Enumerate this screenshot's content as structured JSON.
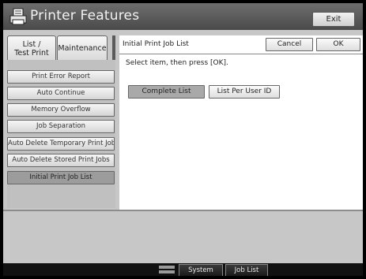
{
  "header": {
    "title": "Printer Features",
    "exit_label": "Exit"
  },
  "tabs": [
    {
      "label": "List / Test Print"
    },
    {
      "label": "Maintenance"
    }
  ],
  "menu_items": [
    {
      "label": "Print Error Report"
    },
    {
      "label": "Auto Continue"
    },
    {
      "label": "Memory Overflow"
    },
    {
      "label": "Job Separation"
    },
    {
      "label": "Auto Delete Temporary Print Jobs"
    },
    {
      "label": "Auto Delete Stored Print Jobs"
    },
    {
      "label": "Initial Print Job List",
      "selected": true
    }
  ],
  "dialog": {
    "title": "Initial Print Job List",
    "cancel_label": "Cancel",
    "ok_label": "OK",
    "instruction": "Select item, then press [OK].",
    "options": [
      {
        "label": "Complete List",
        "selected": true
      },
      {
        "label": "List Per User ID",
        "selected": false
      }
    ]
  },
  "statusbar": {
    "system_status_label": "System Status",
    "job_list_label": "Job List"
  },
  "colors": {
    "header_bg": "#5a5a5a",
    "screen_bg": "#c7c7c7",
    "selected_bg": "#a9a9a9"
  }
}
